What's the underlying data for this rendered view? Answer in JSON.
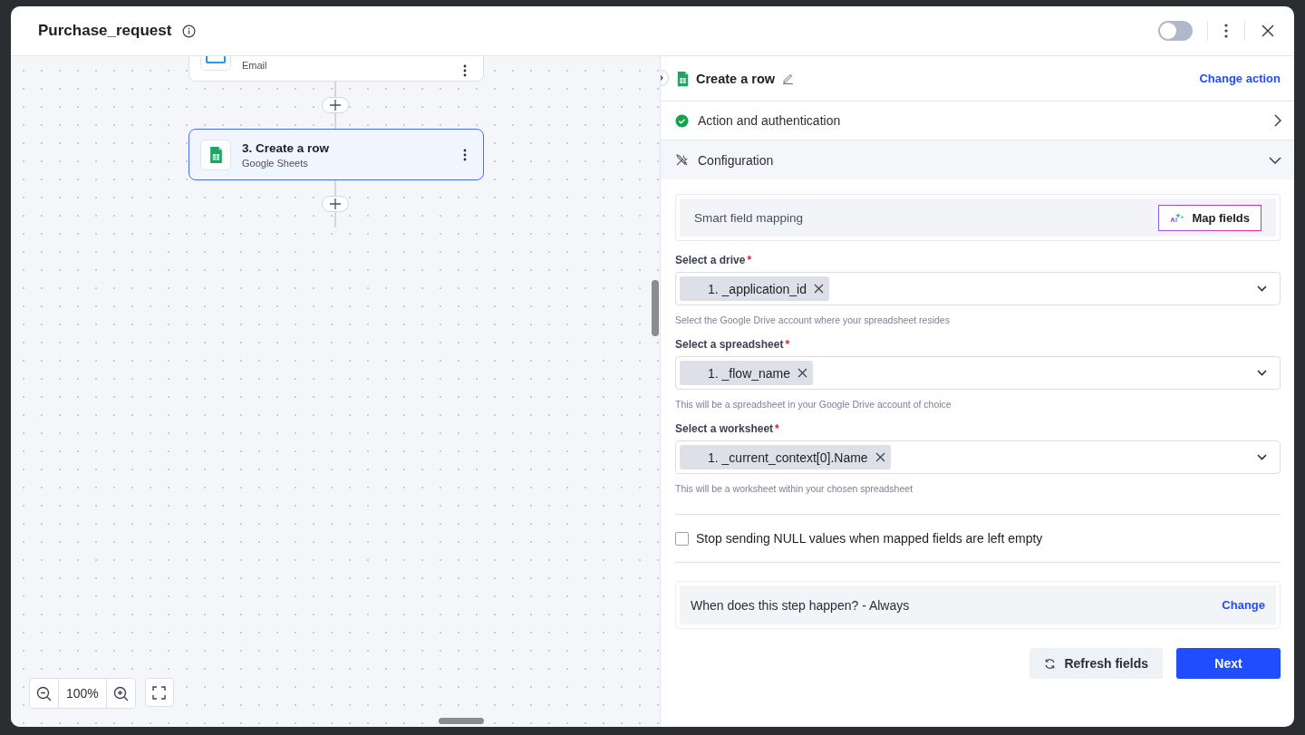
{
  "window": {
    "title": "Purchase_request",
    "toggle_on": false
  },
  "canvas": {
    "nodes": [
      {
        "kind": "email",
        "subtitle": "Email",
        "selected": false
      },
      {
        "kind": "sheets",
        "title": "3. Create a row",
        "subtitle": "Google Sheets",
        "selected": true
      }
    ],
    "zoom": "100%"
  },
  "panel": {
    "title": "Create a row",
    "change_action": "Change action",
    "sections": [
      {
        "kind": "auth",
        "label": "Action and authentication",
        "expanded": false,
        "done": true
      },
      {
        "kind": "config",
        "label": "Configuration",
        "expanded": true
      }
    ],
    "smart_mapping": {
      "label": "Smart field mapping",
      "button": "Map fields"
    },
    "fields": [
      {
        "label": "Select a drive",
        "required_mark": "*",
        "tags": [
          "1. _application_id"
        ],
        "help": "Select the Google Drive account where your spreadsheet resides"
      },
      {
        "label": "Select a spreadsheet",
        "required_mark": "*",
        "tags": [
          "1. _flow_name"
        ],
        "help": "This will be a spreadsheet in your Google Drive account of choice"
      },
      {
        "label": "Select a worksheet",
        "required_mark": "*",
        "tags": [
          "1. _current_context[0].Name"
        ],
        "help": "This will be a worksheet within your chosen spreadsheet"
      }
    ],
    "checkbox": {
      "label": "Stop sending NULL values when mapped fields are left empty",
      "checked": false
    },
    "condition": {
      "text": "When does this step happen? - Always",
      "link": "Change"
    },
    "buttons": [
      {
        "kind": "secondary",
        "label": "Refresh fields"
      },
      {
        "kind": "primary",
        "label": "Next"
      }
    ]
  }
}
